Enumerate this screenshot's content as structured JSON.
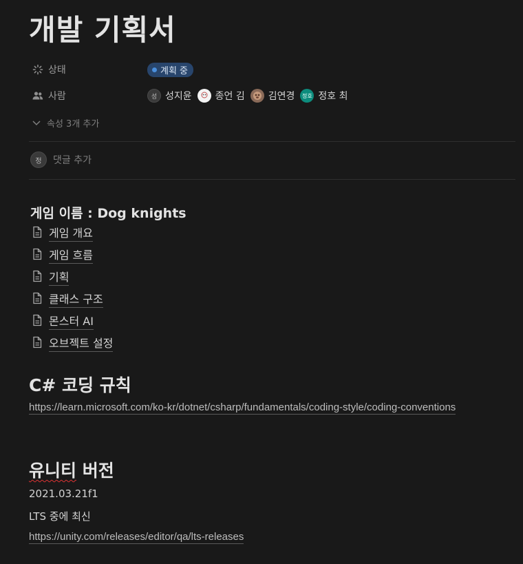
{
  "page": {
    "title": "개발 기획서"
  },
  "properties": {
    "status": {
      "label": "상태",
      "icon": "loading-icon",
      "value": "계획 중",
      "pill_bg": "#28456c",
      "dot_color": "#4a8fdc"
    },
    "people": {
      "label": "사람",
      "icon": "people-icon",
      "persons": [
        {
          "initial": "성",
          "name": "성지윤"
        },
        {
          "initial": "",
          "name": "종언 김"
        },
        {
          "initial": "",
          "name": "김연경"
        },
        {
          "initial": "정호",
          "name": "정호 최"
        }
      ]
    },
    "more": "속성 3개 추가"
  },
  "comment": {
    "avatar_initial": "정",
    "placeholder": "댓글 추가"
  },
  "game_section": {
    "heading": "게임 이름 : Dog knights",
    "links": [
      "게임 개요",
      "게임 흐름",
      "기획",
      "클래스 구조",
      "몬스터 AI",
      "오브젝트 설정"
    ]
  },
  "coding_section": {
    "heading": "C# 코딩 규칙",
    "url": "https://learn.microsoft.com/ko-kr/dotnet/csharp/fundamentals/coding-style/coding-conventions"
  },
  "unity_section": {
    "heading_part1": "유니티",
    "heading_part2": " 버전",
    "version": "2021.03.21f1",
    "note": "LTS 중에 최신",
    "url": "https://unity.com/releases/editor/qa/lts-releases"
  }
}
